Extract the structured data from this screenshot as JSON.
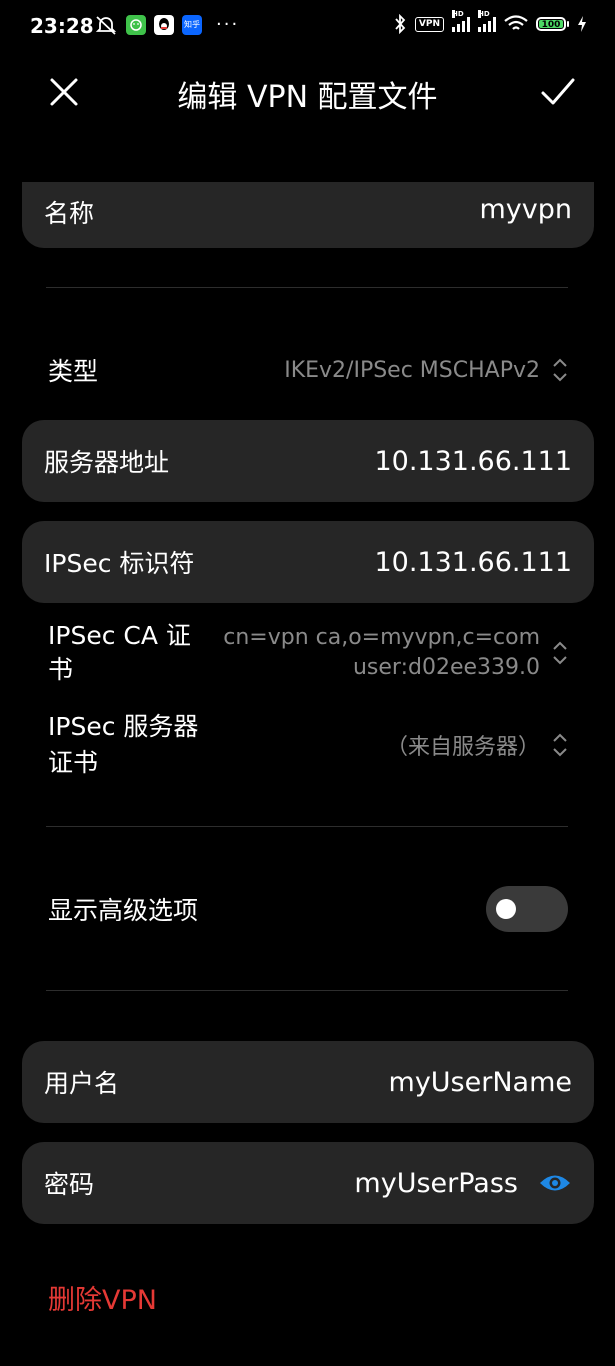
{
  "status_bar": {
    "time": "23:28",
    "vpn_badge": "VPN",
    "battery": "100",
    "icons": [
      "mute-icon",
      "wechat-icon",
      "qq-icon",
      "zhihu-icon",
      "more-dots-icon",
      "bluetooth-icon",
      "vpn-icon",
      "signal-icon",
      "signal-icon",
      "wifi-icon",
      "battery-icon",
      "charging-icon"
    ],
    "zhihu_label": "知乎",
    "more": "···",
    "hd1": "HD",
    "hd2": "HD"
  },
  "header": {
    "title": "编辑 VPN 配置文件",
    "close_icon": "close-icon",
    "confirm_icon": "check-icon"
  },
  "form": {
    "name": {
      "label": "名称",
      "value": "myvpn"
    },
    "type": {
      "label": "类型",
      "value": "IKEv2/IPSec MSCHAPv2"
    },
    "server": {
      "label": "服务器地址",
      "value": "10.131.66.111"
    },
    "ipsec_id": {
      "label": "IPSec 标识符",
      "value": "10.131.66.111"
    },
    "ca_cert": {
      "label_line1": "IPSec CA 证",
      "label_line2": "书",
      "value_line1": "cn=vpn ca,o=myvpn,c=com",
      "value_line2": "user:d02ee339.0"
    },
    "server_cert": {
      "label_line1": "IPSec 服务器",
      "label_line2": "证书",
      "value": "（来自服务器）"
    },
    "advanced": {
      "label": "显示高级选项",
      "enabled": false
    },
    "username": {
      "label": "用户名",
      "value": "myUserName"
    },
    "password": {
      "label": "密码",
      "value": "myUserPass"
    }
  },
  "delete_label": "删除VPN",
  "colors": {
    "background": "#000000",
    "card": "#262626",
    "danger": "#e53935",
    "eye": "#1e88e5",
    "muted": "#8a8a8a"
  }
}
